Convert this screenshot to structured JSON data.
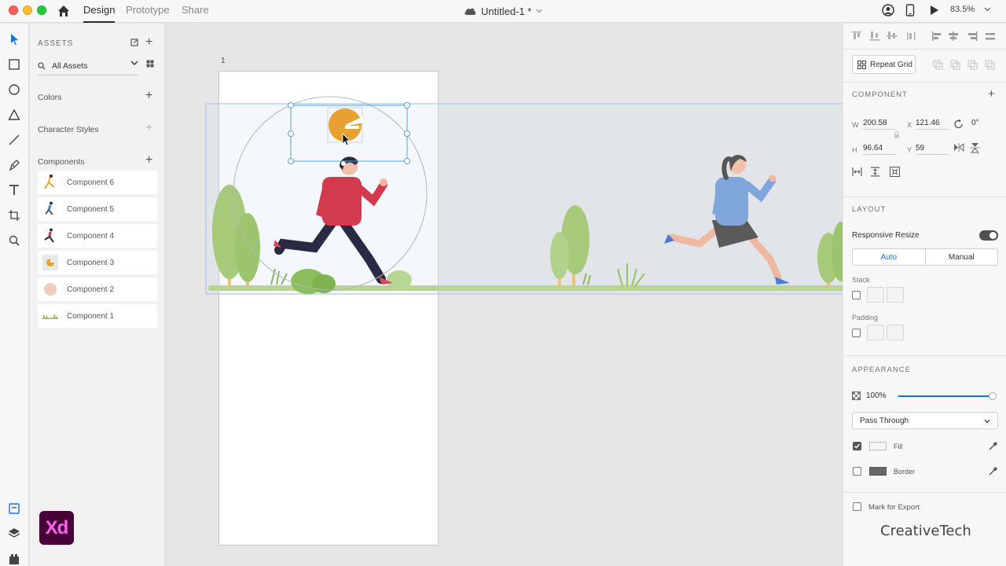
{
  "titlebar": {
    "tabs": [
      "Design",
      "Prototype",
      "Share"
    ],
    "document_title": "Untitled-1 *",
    "zoom": "83.5%"
  },
  "assets": {
    "heading": "ASSETS",
    "filter": "All Assets",
    "sections": {
      "colors": "Colors",
      "character_styles": "Character Styles",
      "components": "Components"
    },
    "components": [
      {
        "name": "Component 6"
      },
      {
        "name": "Component 5"
      },
      {
        "name": "Component 4"
      },
      {
        "name": "Component 3"
      },
      {
        "name": "Component 2"
      },
      {
        "name": "Component 1"
      }
    ]
  },
  "canvas": {
    "artboard_name": "1"
  },
  "props": {
    "repeat_grid": "Repeat Grid",
    "component_title": "COMPONENT",
    "w_label": "W",
    "w": "200.58",
    "h_label": "H",
    "h": "96.64",
    "x_label": "X",
    "x": "121.46",
    "y_label": "Y",
    "y": "59",
    "rotation": "0°",
    "layout_title": "LAYOUT",
    "responsive_resize": "Responsive Resize",
    "auto": "Auto",
    "manual": "Manual",
    "stack": "Stack",
    "padding": "Padding",
    "appearance_title": "APPEARANCE",
    "opacity": "100%",
    "opacity_value": 1.0,
    "blend_mode": "Pass Through",
    "fill": "Fill",
    "border": "Border",
    "mark_for_export": "Mark for Export"
  },
  "watermark": "CreativeTech",
  "colors": {
    "accent": "#1473e6",
    "selection": "#5aa0d8",
    "xd_bg": "#470137",
    "xd_fg": "#ff61f6"
  }
}
